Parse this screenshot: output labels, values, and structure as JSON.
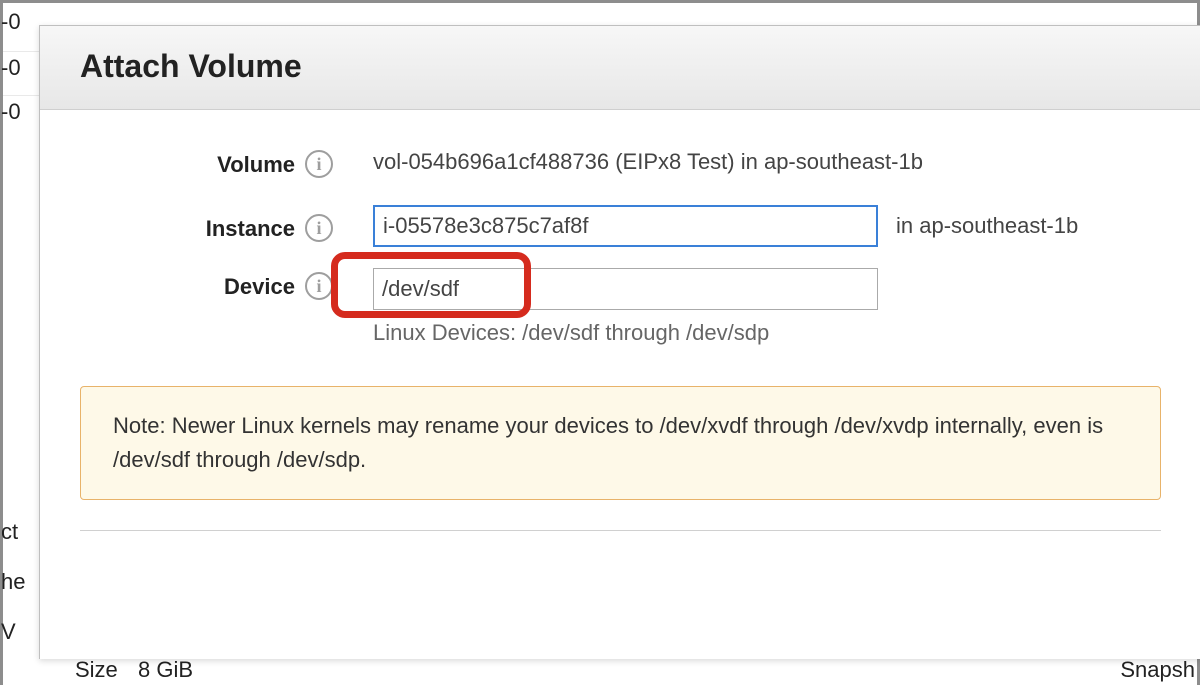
{
  "background": {
    "left_items": [
      "-0",
      "-0",
      "-0",
      "ct",
      "he",
      "V"
    ],
    "bottom_left_1": "Size",
    "bottom_left_2": "8 GiB",
    "bottom_right": "Snapsh"
  },
  "modal": {
    "title": "Attach Volume",
    "fields": {
      "volume": {
        "label": "Volume",
        "value": "vol-054b696a1cf488736 (EIPx8 Test) in ap-southeast-1b"
      },
      "instance": {
        "label": "Instance",
        "value": "i-05578e3c875c7af8f",
        "suffix": "in ap-southeast-1b"
      },
      "device": {
        "label": "Device",
        "value": "/dev/sdf",
        "hint": "Linux Devices: /dev/sdf through /dev/sdp"
      }
    },
    "note": "Note: Newer Linux kernels may rename your devices to /dev/xvdf through /dev/xvdp internally, even is /dev/sdf through /dev/sdp."
  }
}
